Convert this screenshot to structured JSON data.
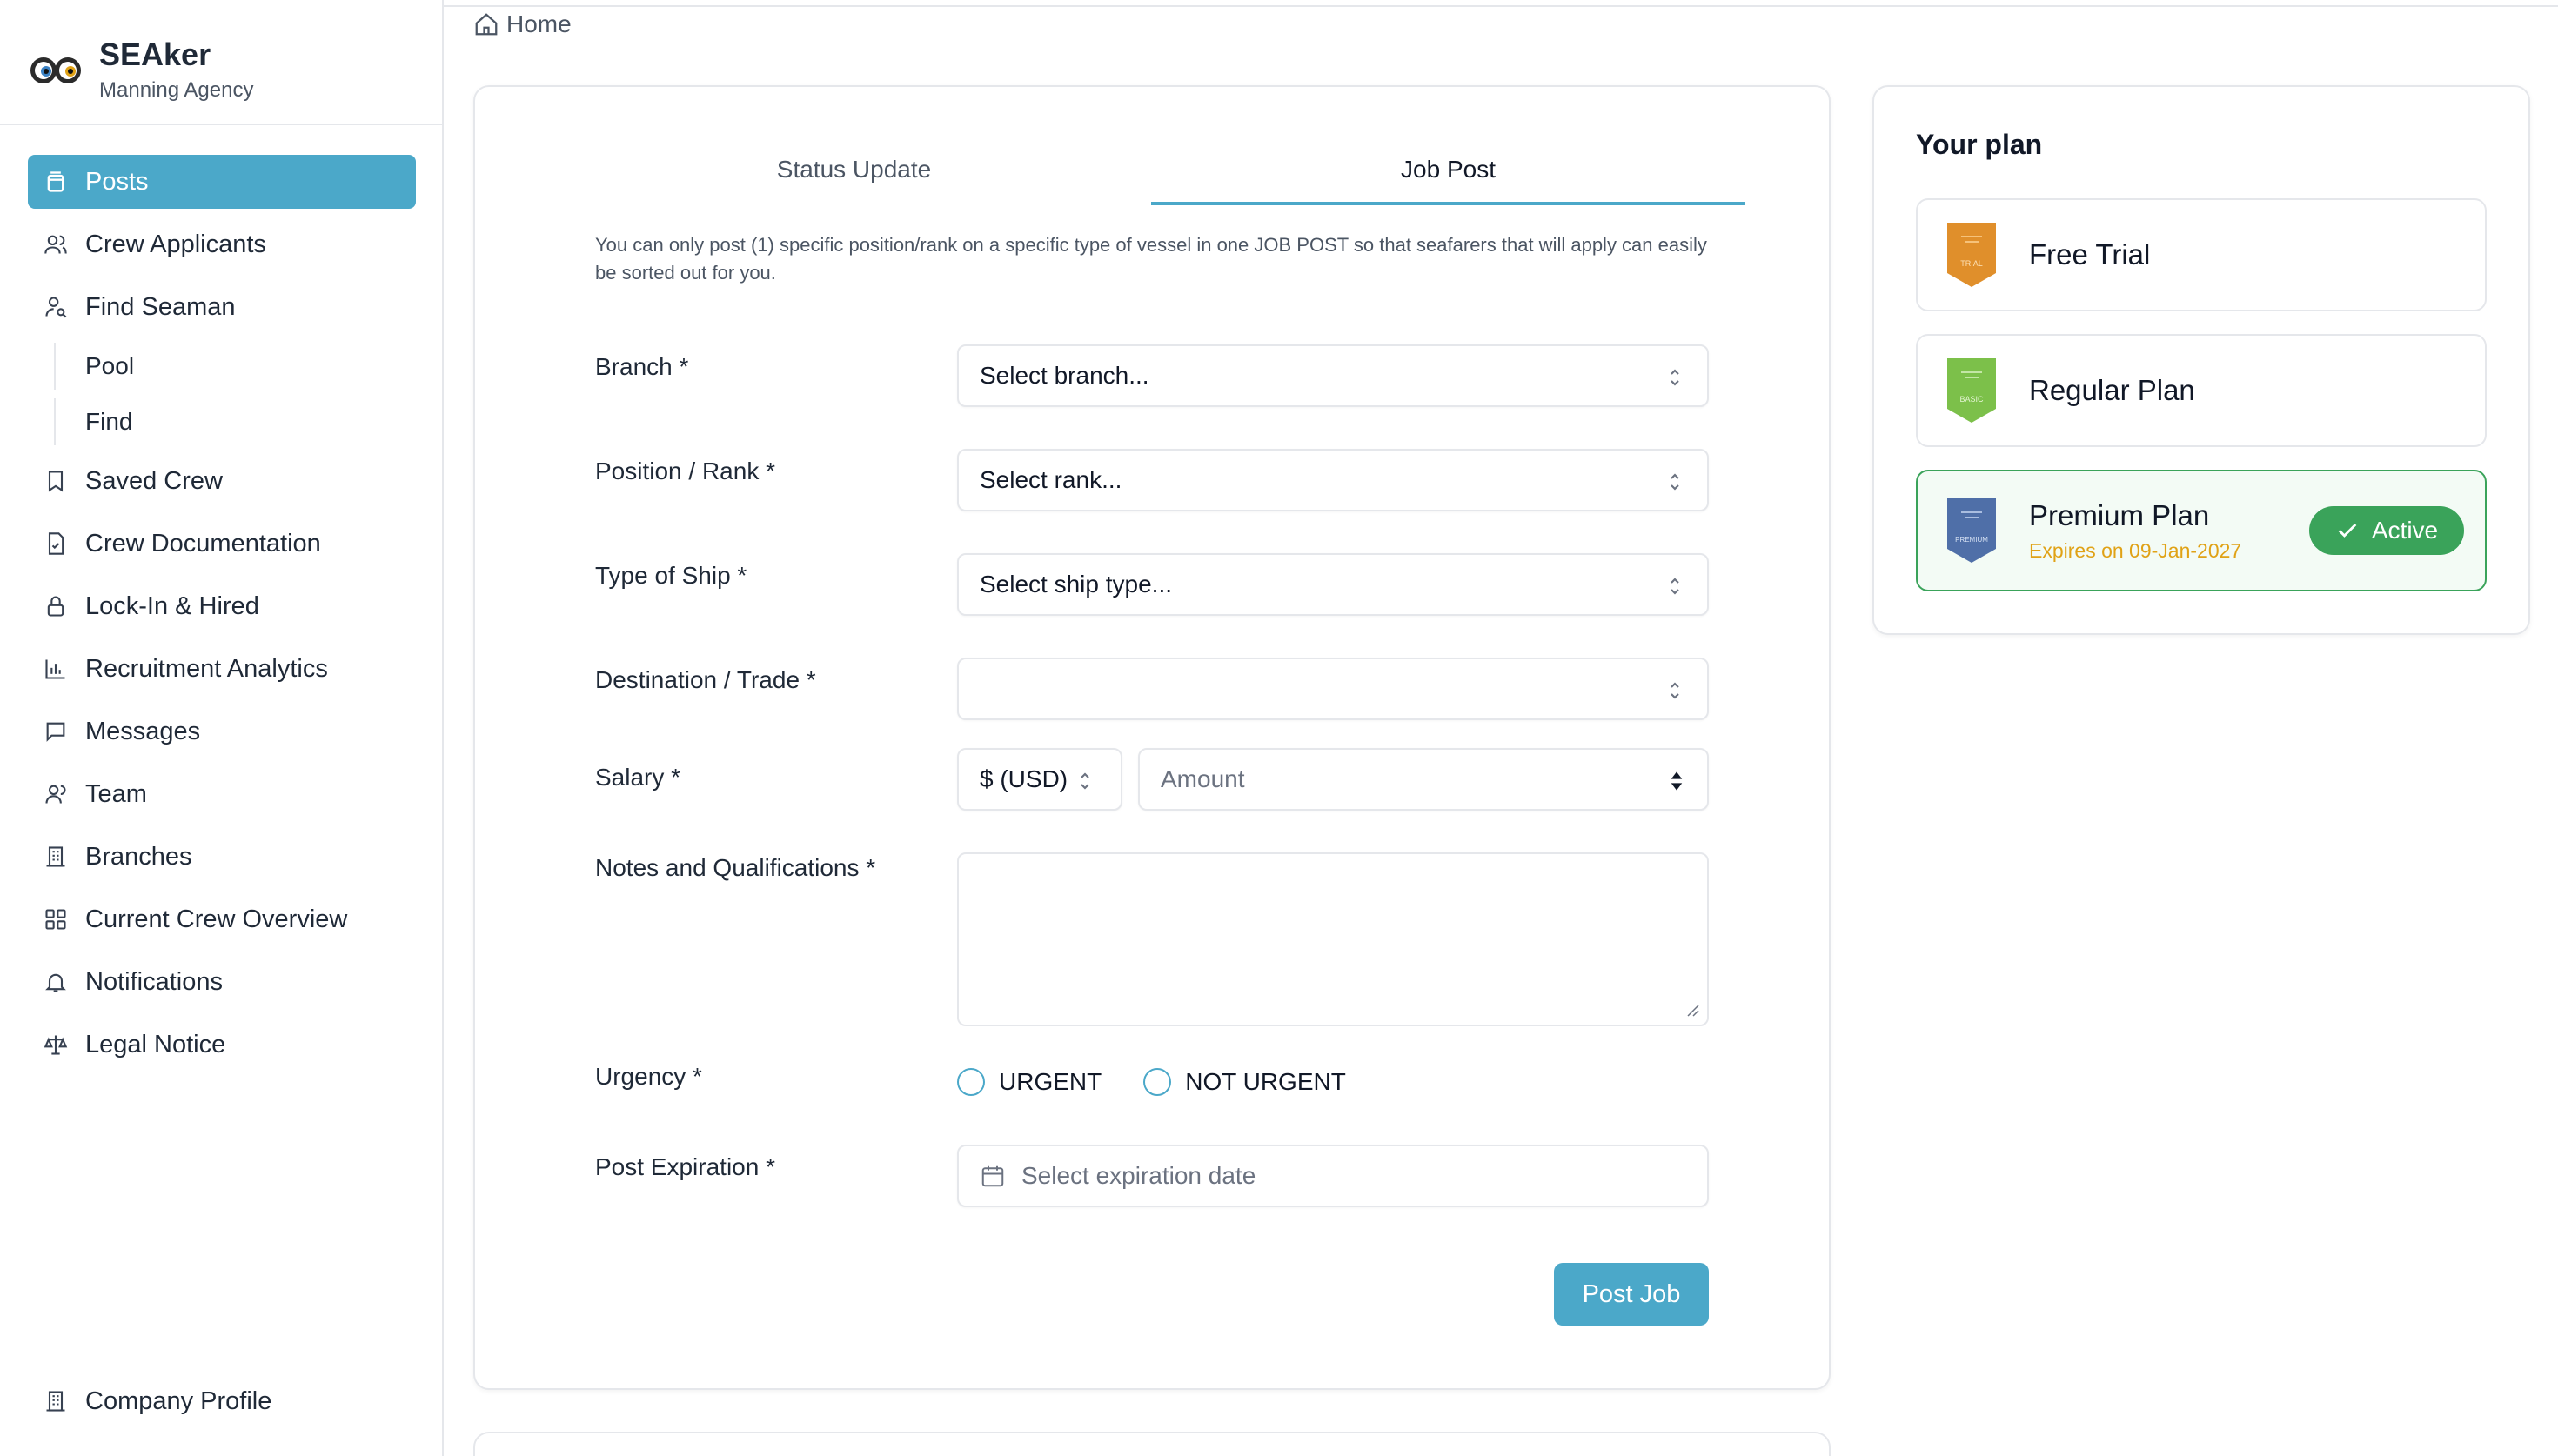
{
  "brand": {
    "name": "SEAker",
    "subtitle": "Manning Agency"
  },
  "sidebar": {
    "items": [
      {
        "label": "Posts",
        "icon": "posts-icon"
      },
      {
        "label": "Crew Applicants",
        "icon": "users-icon"
      },
      {
        "label": "Find Seaman",
        "icon": "user-search-icon"
      },
      {
        "label": "Pool"
      },
      {
        "label": "Find"
      },
      {
        "label": "Saved Crew",
        "icon": "bookmark-icon"
      },
      {
        "label": "Crew Documentation",
        "icon": "document-check-icon"
      },
      {
        "label": "Lock-In & Hired",
        "icon": "lock-icon"
      },
      {
        "label": "Recruitment Analytics",
        "icon": "bar-chart-icon"
      },
      {
        "label": "Messages",
        "icon": "message-icon"
      },
      {
        "label": "Team",
        "icon": "team-icon"
      },
      {
        "label": "Branches",
        "icon": "building-icon"
      },
      {
        "label": "Current Crew Overview",
        "icon": "grid-icon"
      },
      {
        "label": "Notifications",
        "icon": "bell-icon"
      },
      {
        "label": "Legal Notice",
        "icon": "scale-icon"
      }
    ],
    "bottom": {
      "label": "Company Profile",
      "icon": "building-icon"
    }
  },
  "breadcrumb": {
    "label": "Home"
  },
  "tabs": [
    {
      "label": "Status Update"
    },
    {
      "label": "Job Post"
    }
  ],
  "form": {
    "notice": "You can only post (1) specific position/rank on a specific type of vessel in one JOB POST so that seafarers that will apply can easily be sorted out for you.",
    "branch": {
      "label": "Branch *",
      "value": "Select branch..."
    },
    "position": {
      "label": "Position / Rank *",
      "value": "Select rank..."
    },
    "ship": {
      "label": "Type of Ship *",
      "value": "Select ship type..."
    },
    "destination": {
      "label": "Destination / Trade *",
      "value": ""
    },
    "salary": {
      "label": "Salary *",
      "currency": "$ (USD)",
      "amount_placeholder": "Amount"
    },
    "notes": {
      "label": "Notes and Qualifications *"
    },
    "urgency": {
      "label": "Urgency *",
      "options": [
        "URGENT",
        "NOT URGENT"
      ]
    },
    "expiration": {
      "label": "Post Expiration *",
      "placeholder": "Select expiration date"
    },
    "submit": "Post Job"
  },
  "plans": {
    "title": "Your plan",
    "items": [
      {
        "name": "Free Trial",
        "badge_text": "TRIAL",
        "color": "#e08f2b"
      },
      {
        "name": "Regular Plan",
        "badge_text": "BASIC",
        "color": "#7cc04a"
      },
      {
        "name": "Premium Plan",
        "badge_text": "PREMIUM",
        "color": "#4f6fa8",
        "expires": "Expires on 09-Jan-2027",
        "status": "Active"
      }
    ]
  },
  "colors": {
    "accent": "#4ba8c9",
    "active_green": "#3aa35a",
    "expiry": "#e0a216"
  }
}
